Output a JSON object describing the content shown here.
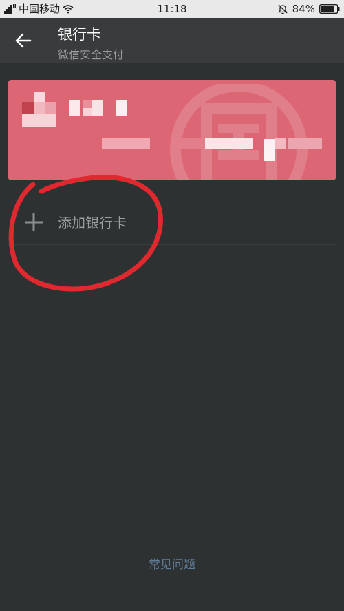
{
  "status_bar": {
    "carrier": "中国移动",
    "time": "11:18",
    "battery": "84%",
    "battery_level": 0.84
  },
  "header": {
    "title": "银行卡",
    "subtitle": "微信安全支付"
  },
  "bank_card": {
    "color": "#dc6674"
  },
  "add_card": {
    "label": "添加银行卡"
  },
  "footer": {
    "faq_label": "常见问题"
  },
  "colors": {
    "background": "#2e3132",
    "header": "#393b3c",
    "card": "#dc6674",
    "annotation": "#e0292f",
    "link": "#5f7c98"
  },
  "icons": [
    "signal-icon",
    "wifi-icon",
    "bell-mute-icon",
    "battery-icon",
    "back-arrow-icon",
    "plus-icon"
  ]
}
